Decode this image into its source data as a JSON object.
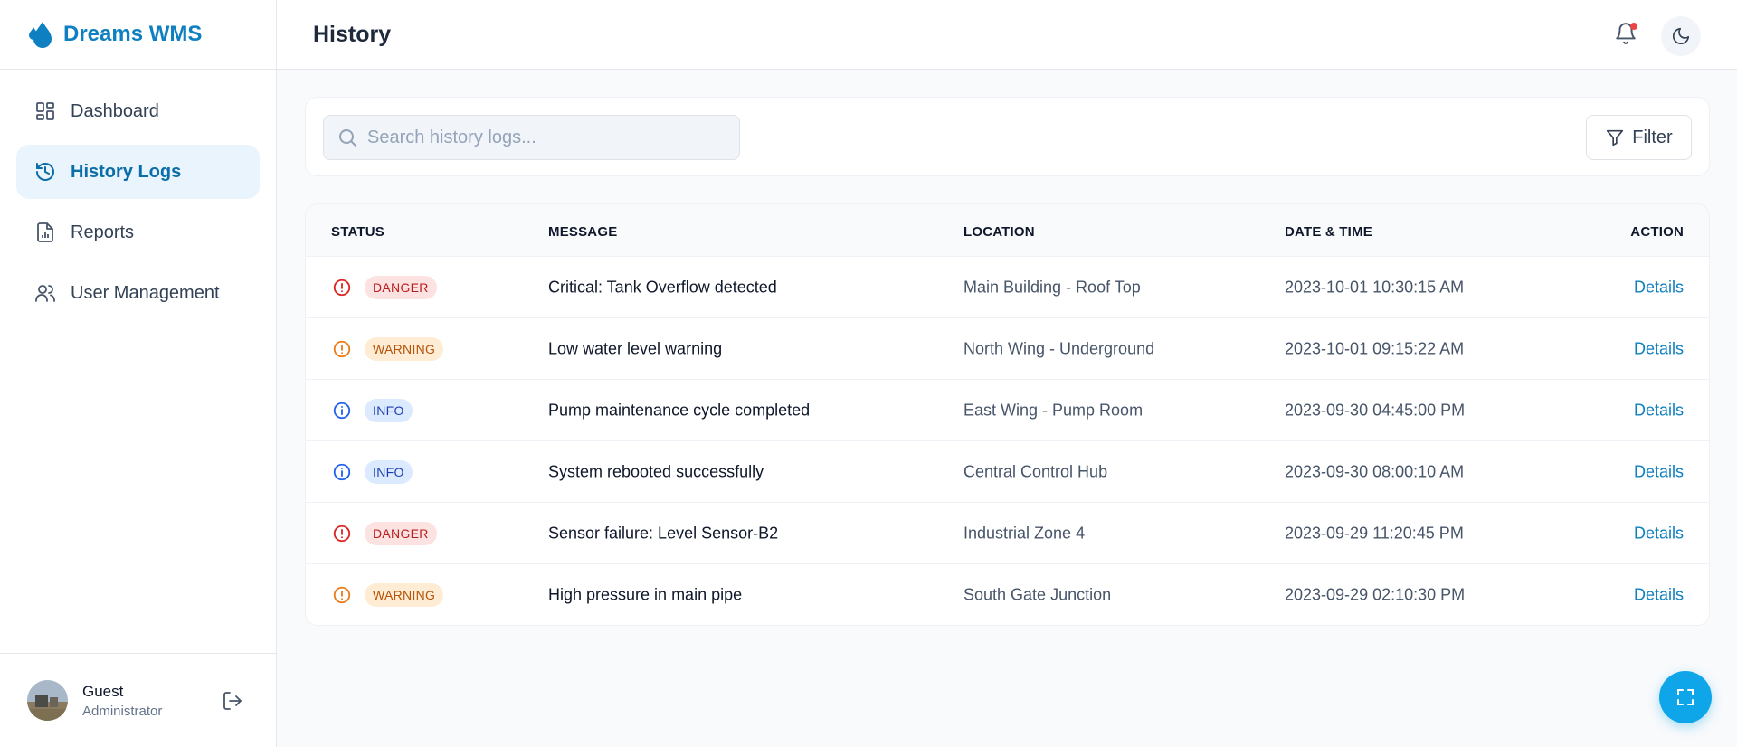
{
  "brand": {
    "name": "Dreams WMS"
  },
  "sidebar": {
    "items": [
      {
        "label": "Dashboard",
        "icon": "dashboard-icon"
      },
      {
        "label": "History Logs",
        "icon": "history-icon",
        "active": true
      },
      {
        "label": "Reports",
        "icon": "report-icon"
      },
      {
        "label": "User Management",
        "icon": "users-icon"
      }
    ]
  },
  "user": {
    "name": "Guest",
    "role": "Administrator"
  },
  "header": {
    "title": "History"
  },
  "search": {
    "placeholder": "Search history logs..."
  },
  "filter": {
    "label": "Filter"
  },
  "table": {
    "columns": [
      "STATUS",
      "MESSAGE",
      "LOCATION",
      "DATE & TIME",
      "ACTION"
    ],
    "rows": [
      {
        "status": "DANGER",
        "message": "Critical: Tank Overflow detected",
        "location": "Main Building - Roof Top",
        "datetime": "2023-10-01 10:30:15 AM",
        "action": "Details"
      },
      {
        "status": "WARNING",
        "message": "Low water level warning",
        "location": "North Wing - Underground",
        "datetime": "2023-10-01 09:15:22 AM",
        "action": "Details"
      },
      {
        "status": "INFO",
        "message": "Pump maintenance cycle completed",
        "location": "East Wing - Pump Room",
        "datetime": "2023-09-30 04:45:00 PM",
        "action": "Details"
      },
      {
        "status": "INFO",
        "message": "System rebooted successfully",
        "location": "Central Control Hub",
        "datetime": "2023-09-30 08:00:10 AM",
        "action": "Details"
      },
      {
        "status": "DANGER",
        "message": "Sensor failure: Level Sensor-B2",
        "location": "Industrial Zone 4",
        "datetime": "2023-09-29 11:20:45 PM",
        "action": "Details"
      },
      {
        "status": "WARNING",
        "message": "High pressure in main pipe",
        "location": "South Gate Junction",
        "datetime": "2023-09-29 02:10:30 PM",
        "action": "Details"
      }
    ]
  },
  "colors": {
    "accent": "#0e7fc0",
    "danger": "#dc2626",
    "warning": "#ea7c1a",
    "info": "#2563eb",
    "fab": "#0ea5e9"
  }
}
